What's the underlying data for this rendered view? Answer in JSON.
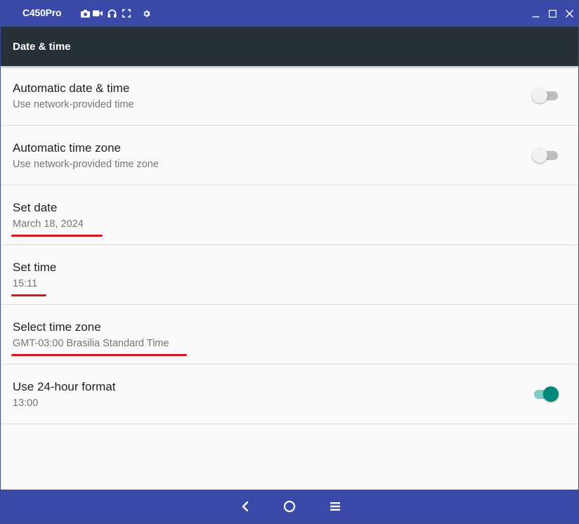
{
  "window": {
    "app_title": "C450Pro",
    "toolbar_icons": [
      "camera-icon",
      "video-camera-icon",
      "headset-icon",
      "fullscreen-icon",
      "gear-icon"
    ],
    "controls": [
      "minimize-icon",
      "maximize-icon",
      "close-icon"
    ]
  },
  "actionbar": {
    "title": "Date & time"
  },
  "settings": {
    "auto_date": {
      "title": "Automatic date & time",
      "summary": "Use network-provided time",
      "enabled": false
    },
    "auto_zone": {
      "title": "Automatic time zone",
      "summary": "Use network-provided time zone",
      "enabled": false
    },
    "set_date": {
      "title": "Set date",
      "summary": "March 18, 2024"
    },
    "set_time": {
      "title": "Set time",
      "summary": "15:11"
    },
    "time_zone": {
      "title": "Select time zone",
      "summary": "GMT-03:00 Brasilia Standard Time"
    },
    "hour_format": {
      "title": "Use 24-hour format",
      "summary": "13:00",
      "enabled": true
    }
  },
  "navbar": {
    "buttons": [
      "back-icon",
      "home-icon",
      "menu-icon"
    ]
  },
  "colors": {
    "titlebar": "#3b4aa8",
    "actionbar": "#263238",
    "accent": "#00897b",
    "annotation_underline": "#d5181f"
  }
}
